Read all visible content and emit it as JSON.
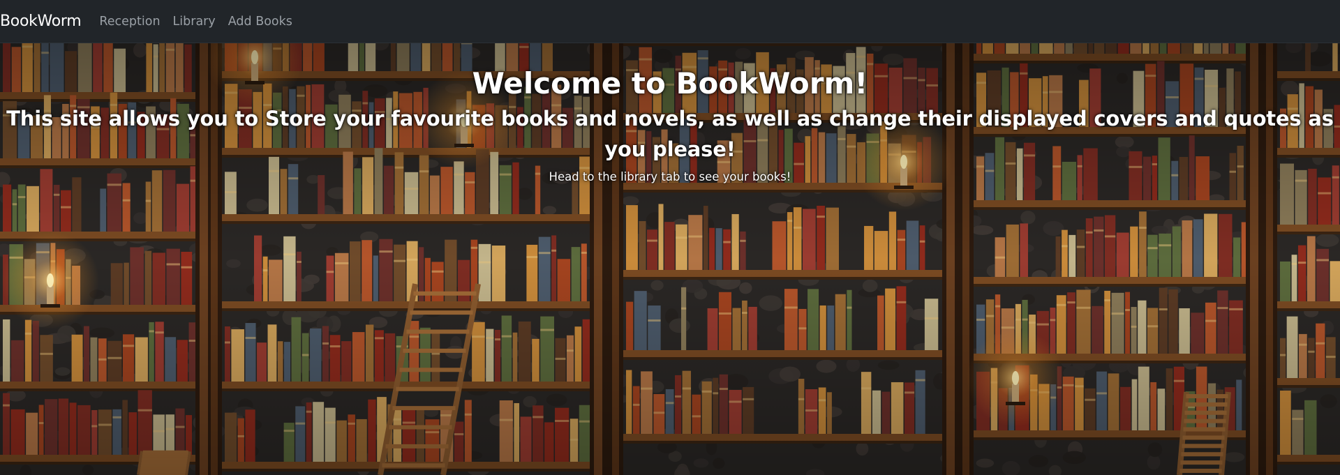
{
  "nav": {
    "brand": "BookWorm",
    "links": [
      "Reception",
      "Library",
      "Add Books"
    ]
  },
  "hero": {
    "title": "Welcome to BookWorm!",
    "subtitle": "This site allows you to Store your favourite books and novels, as well as change their displayed covers and quotes as you please!",
    "note": "Head to the library tab to see your books!"
  },
  "colors": {
    "navbar": "#212529",
    "nav_link": "#9aa0a6",
    "brand": "#ffffff",
    "shelf_wood": "#7a4a22",
    "wall_stone": "#2a2725"
  },
  "background_image": "bookshelf-wall-with-candles-and-ladders"
}
